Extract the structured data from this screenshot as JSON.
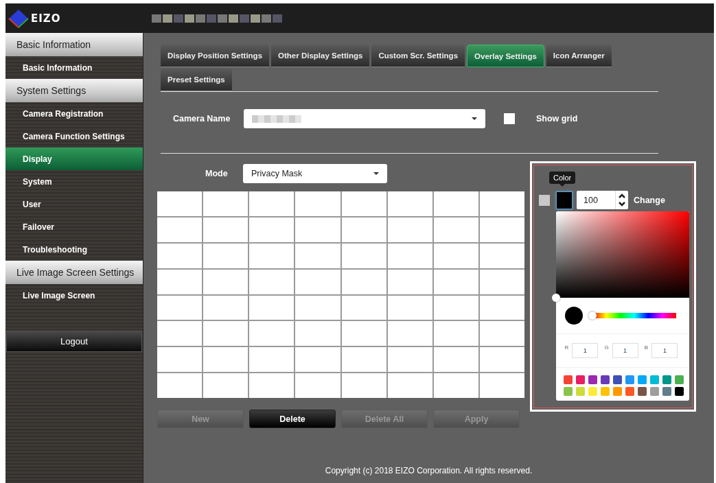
{
  "header": {
    "logo": "EIZO"
  },
  "sidebar": {
    "sections": [
      {
        "heading": "Basic Information",
        "items": [
          {
            "label": "Basic Information",
            "selected": false
          }
        ]
      },
      {
        "heading": "System Settings",
        "items": [
          {
            "label": "Camera Registration",
            "selected": false
          },
          {
            "label": "Camera Function Settings",
            "selected": false
          },
          {
            "label": "Display",
            "selected": true
          },
          {
            "label": "System",
            "selected": false
          },
          {
            "label": "User",
            "selected": false
          },
          {
            "label": "Failover",
            "selected": false
          },
          {
            "label": "Troubleshooting",
            "selected": false
          }
        ]
      },
      {
        "heading": "Live Image Screen Settings",
        "items": [
          {
            "label": "Live Image Screen",
            "selected": false
          }
        ]
      }
    ],
    "logout": "Logout"
  },
  "tabs": [
    {
      "label": "Display Position Settings",
      "selected": false
    },
    {
      "label": "Other Display Settings",
      "selected": false
    },
    {
      "label": "Custom Scr. Settings",
      "selected": false
    },
    {
      "label": "Overlay Settings",
      "selected": true
    },
    {
      "label": "Icon Arranger",
      "selected": false
    },
    {
      "label": "Preset Settings",
      "selected": false
    }
  ],
  "camera_name": {
    "label": "Camera Name"
  },
  "show_grid": {
    "label": "Show grid",
    "checked": false
  },
  "mode": {
    "label": "Mode",
    "value": "Privacy Mask"
  },
  "mask_grid": {
    "rows": [
      {
        "cells": [
          {
            "masked": false
          },
          {
            "masked": false
          },
          {
            "masked": false
          },
          {
            "masked": false
          },
          {
            "masked": false
          },
          {
            "masked": false
          },
          {
            "masked": false
          },
          {
            "masked": false
          }
        ]
      },
      {
        "cells": [
          {
            "masked": false
          },
          {
            "masked": false
          },
          {
            "masked": false
          },
          {
            "masked": false
          },
          {
            "masked": false
          },
          {
            "masked": false
          },
          {
            "masked": false
          },
          {
            "masked": false
          }
        ]
      },
      {
        "cells": [
          {
            "masked": false
          },
          {
            "masked": false
          },
          {
            "masked": false
          },
          {
            "masked": false
          },
          {
            "masked": false
          },
          {
            "masked": false
          },
          {
            "masked": false
          },
          {
            "masked": false
          }
        ]
      },
      {
        "cells": [
          {
            "masked": false
          },
          {
            "masked": false
          },
          {
            "masked": false
          },
          {
            "masked": false
          },
          {
            "masked": false
          },
          {
            "masked": false
          },
          {
            "masked": false
          },
          {
            "masked": false
          }
        ]
      },
      {
        "cells": [
          {
            "masked": false
          },
          {
            "masked": false
          },
          {
            "masked": false
          },
          {
            "masked": false
          },
          {
            "masked": false
          },
          {
            "masked": false
          },
          {
            "masked": false
          },
          {
            "masked": false
          }
        ]
      },
      {
        "cells": [
          {
            "masked": false
          },
          {
            "masked": false
          },
          {
            "masked": false
          },
          {
            "masked": false
          },
          {
            "masked": false
          },
          {
            "masked": false
          },
          {
            "masked": false
          },
          {
            "masked": false
          }
        ]
      },
      {
        "cells": [
          {
            "masked": false
          },
          {
            "masked": false
          },
          {
            "masked": false
          },
          {
            "masked": false
          },
          {
            "masked": false
          },
          {
            "masked": false
          },
          {
            "masked": false
          },
          {
            "masked": false
          }
        ]
      },
      {
        "cells": [
          {
            "masked": false
          },
          {
            "masked": false
          },
          {
            "masked": false
          },
          {
            "masked": false
          },
          {
            "masked": false
          },
          {
            "masked": false
          },
          {
            "masked": false
          },
          {
            "masked": false
          }
        ]
      }
    ]
  },
  "buttons": [
    {
      "label": "New",
      "disabled": true
    },
    {
      "label": "Delete",
      "disabled": false
    },
    {
      "label": "Delete All",
      "disabled": true
    },
    {
      "label": "Apply",
      "disabled": true
    }
  ],
  "color_panel": {
    "tooltip": "Color",
    "checked": false,
    "opacity": "100",
    "action": "Change",
    "hue": {
      "level": 0
    },
    "rgb": [
      {
        "label": "R",
        "value": "1"
      },
      {
        "label": "G",
        "value": "1"
      },
      {
        "label": "B",
        "value": "1"
      }
    ],
    "palette": [
      {
        "color": "#f44336"
      },
      {
        "color": "#e91e63"
      },
      {
        "color": "#9c27b0"
      },
      {
        "color": "#673ab7"
      },
      {
        "color": "#3f51b5"
      },
      {
        "color": "#2196f3"
      },
      {
        "color": "#03a9f4"
      },
      {
        "color": "#00bcd4"
      },
      {
        "color": "#009688"
      },
      {
        "color": "#4caf50"
      },
      {
        "color": "#8bc34a"
      },
      {
        "color": "#cddc39"
      },
      {
        "color": "#ffeb3b"
      },
      {
        "color": "#ffc107"
      },
      {
        "color": "#ff9800"
      },
      {
        "color": "#ff5722"
      },
      {
        "color": "#795548"
      },
      {
        "color": "#9e9e9e"
      },
      {
        "color": "#607d8b"
      },
      {
        "color": "#000000"
      }
    ]
  },
  "footer": "Copyright (c) 2018 EIZO Corporation. All rights reserved."
}
